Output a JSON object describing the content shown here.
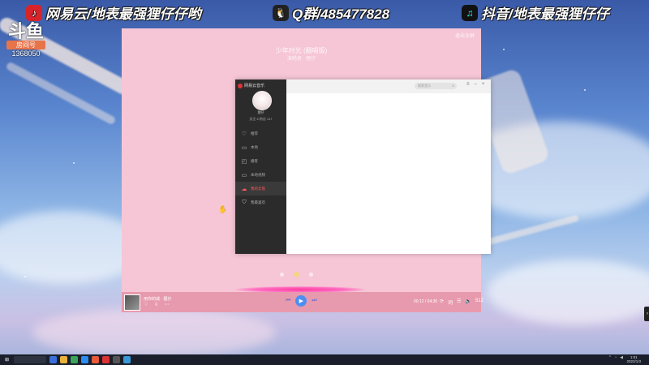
{
  "banner": {
    "netease_label": "网易云/地表最强狸仔仔哟",
    "qq_label": "Q群/485477828",
    "douyin_label": "抖音/地表最强狸仔仔",
    "netease_icon": "netease-music-icon",
    "qq_icon": "qq-icon",
    "douyin_icon": "douyin-icon"
  },
  "room": {
    "logo_text": "斗鱼",
    "tag": "房间号",
    "number": "1368050"
  },
  "player": {
    "title": "少年时光 (翻唱版)",
    "subtitle": "演唱者 - 狸仔",
    "corner_text": "退出全屏",
    "song_line1": "用你的城 - 狸仔",
    "song_line2": "少年时光 (翻唱版)",
    "time": "00:12 / 04:36",
    "quality": "512"
  },
  "music_app": {
    "brand": "网易云音乐",
    "user_name": "狸仔",
    "stats": "关注 6   粉丝 147",
    "search_placeholder": "搜索音乐",
    "menu": [
      {
        "icon": "heart-icon",
        "label": "推荐"
      },
      {
        "icon": "folder-icon",
        "label": "本地"
      },
      {
        "icon": "radio-icon",
        "label": "播客"
      },
      {
        "icon": "monitor-icon",
        "label": "本地视频"
      },
      {
        "icon": "cloud-icon",
        "label": "我的云盘"
      },
      {
        "icon": "shirt-icon",
        "label": "我最喜欢"
      }
    ],
    "active_index": 4
  },
  "taskbar": {
    "time": "1:51",
    "date": "2022/1/3"
  }
}
